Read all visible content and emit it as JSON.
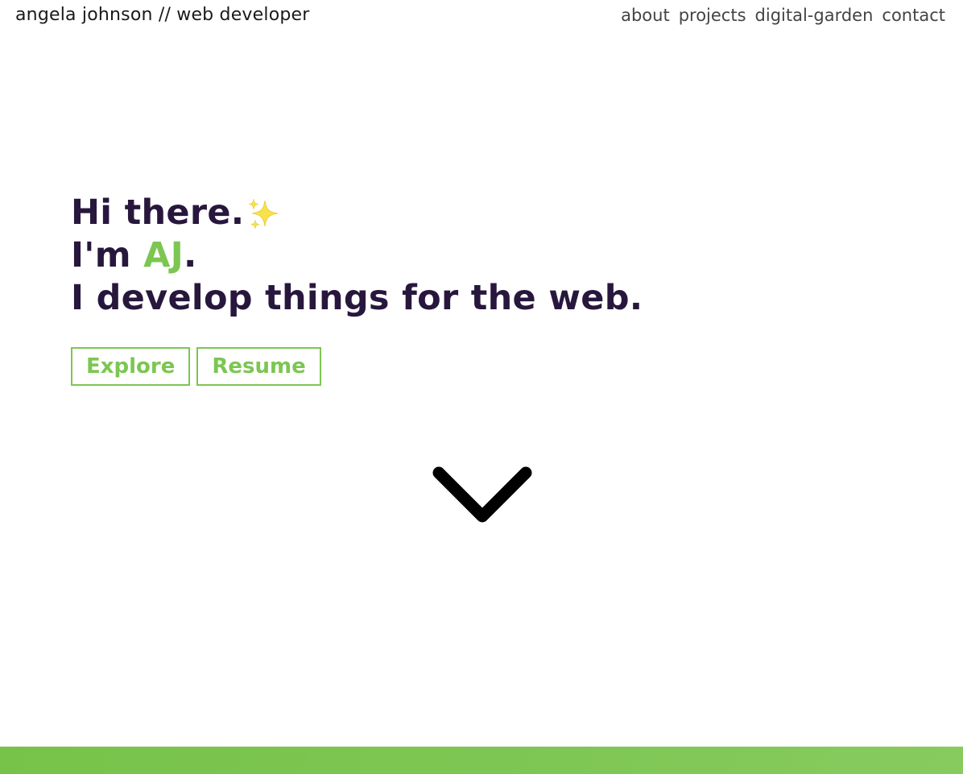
{
  "header": {
    "site_title": "angela johnson // web developer",
    "nav": [
      {
        "label": "about"
      },
      {
        "label": "projects"
      },
      {
        "label": "digital-garden"
      },
      {
        "label": "contact"
      }
    ]
  },
  "hero": {
    "line1": "Hi there.",
    "sparkle_icon": "sparkles-icon",
    "line2_prefix": "I'm ",
    "line2_name": "AJ",
    "line2_suffix": ".",
    "line3": "I develop things for the web."
  },
  "buttons": {
    "explore_label": "Explore",
    "resume_label": "Resume"
  },
  "scroll_icon": "chevron-down-icon",
  "colors": {
    "heading": "#28173d",
    "accent": "#7cc652",
    "nav_text": "#444444",
    "footer_bar": "#7cc652"
  }
}
